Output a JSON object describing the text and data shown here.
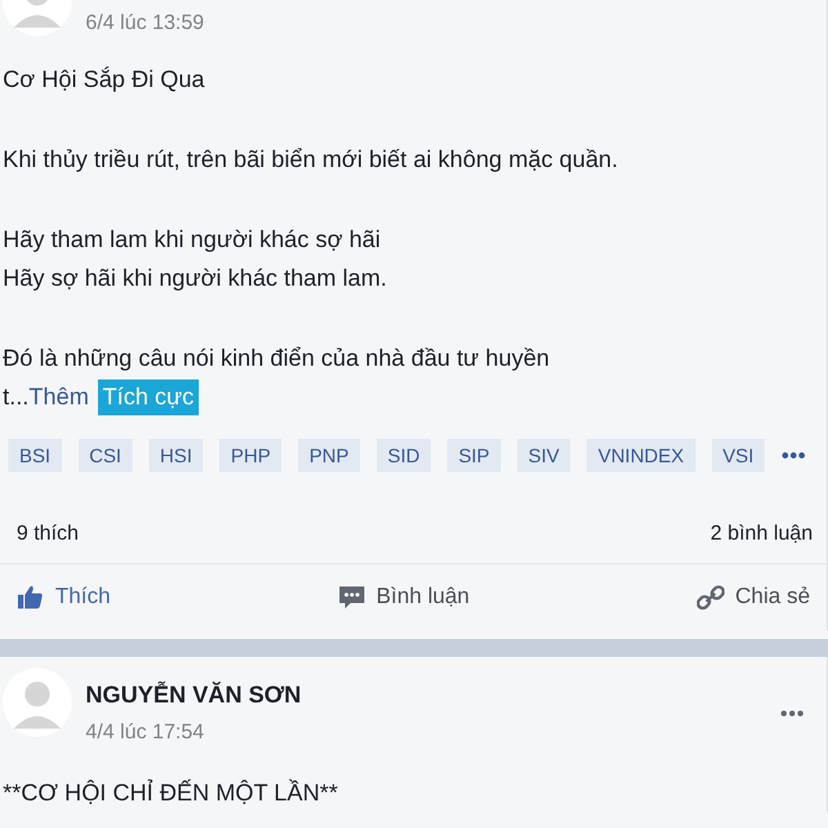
{
  "posts": [
    {
      "date": "6/4 lúc 13:59",
      "paragraphs": [
        [
          "Cơ Hội Sắp Đi Qua"
        ],
        [
          "Khi thủy triều rút, trên bãi biển mới biết ai không mặc quần."
        ],
        [
          "Hãy tham lam khi người khác sợ hãi",
          "Hãy sợ hãi khi người khác tham lam."
        ],
        [
          "Đó là những câu nói kinh điển của nhà đầu tư huyền"
        ]
      ],
      "tail": "t...",
      "more_link": "Thêm",
      "sentiment": "Tích cực",
      "tags": [
        "BSI",
        "CSI",
        "HSI",
        "PHP",
        "PNP",
        "SID",
        "SIP",
        "SIV",
        "VNINDEX",
        "VSI"
      ],
      "likes": "9 thích",
      "comments": "2 bình luận",
      "actions": [
        {
          "kind": "like",
          "label": "Thích"
        },
        {
          "kind": "comment",
          "label": "Bình luận"
        },
        {
          "kind": "share",
          "label": "Chia sẻ"
        }
      ]
    },
    {
      "author": "NGUYỄN VĂN SƠN",
      "date": "4/4 lúc 17:54",
      "paragraphs": [
        [
          "**CƠ HỘI CHỈ ĐẾN MỘT LẦN**"
        ]
      ]
    }
  ]
}
